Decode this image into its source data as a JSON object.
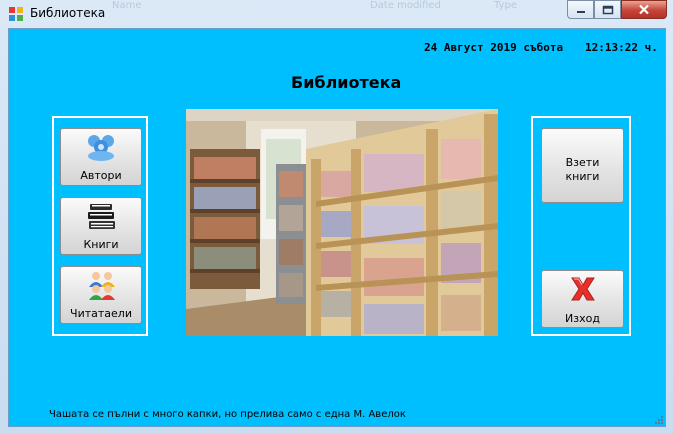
{
  "window": {
    "title": "Библиотека",
    "ghost_text": [
      "Name",
      "Date modified",
      "Type"
    ]
  },
  "header": {
    "date": "24 Август 2019 събота",
    "time": "12:13:22 ч.",
    "title": "Библиотека"
  },
  "left_buttons": [
    {
      "label": "Автори",
      "icon": "authors-icon"
    },
    {
      "label": "Книги",
      "icon": "books-icon"
    },
    {
      "label": "Читатаели",
      "icon": "readers-icon"
    }
  ],
  "right_buttons": {
    "borrowed_line1": "Взети",
    "borrowed_line2": "книги",
    "exit": "Изход"
  },
  "footer": {
    "quote": "Чашата се пълни с много капки, но прелива само с една М. Авелок"
  },
  "colors": {
    "client_bg": "#00bfff",
    "panel_border": "#ffffff",
    "exit_icon": "#e8302a"
  }
}
